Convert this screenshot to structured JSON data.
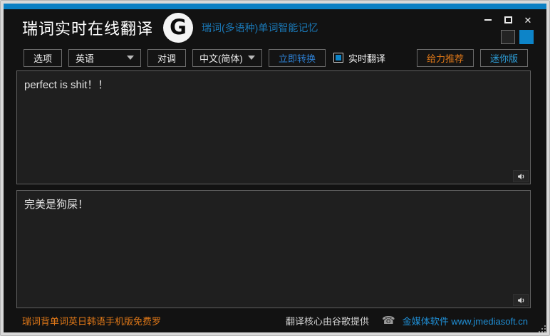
{
  "window": {
    "title": "瑞词实时在线翻译",
    "logo_letter": "G",
    "subtitle": "瑞词(多语种)单词智能记忆",
    "controls": {
      "close_glyph": "✕"
    },
    "skin_swatches": {
      "dark": "#242424",
      "blue": "#0d84c8"
    }
  },
  "toolbar": {
    "options_label": "选项",
    "source_language": "英语",
    "swap_label": "对调",
    "target_language": "中文(简体)",
    "translate_label": "立即转换",
    "realtime_label": "实时翻译",
    "realtime_checked": true,
    "recommend_label": "给力推荐",
    "mini_label": "迷你版"
  },
  "source_panel": {
    "text": "perfect is shit！！"
  },
  "target_panel": {
    "text": "完美是狗屎！"
  },
  "statusbar": {
    "left_link": "瑞词背单词英日韩语手机版免费罗",
    "center_text": "翻译核心由谷歌提供",
    "phone_glyph": "☎",
    "right_link": "金媒体软件 www.jmediasoft.cn"
  },
  "colors": {
    "accent_blue": "#0c80c4",
    "link_blue": "#1f8fd6",
    "highlight_orange": "#e07818"
  }
}
